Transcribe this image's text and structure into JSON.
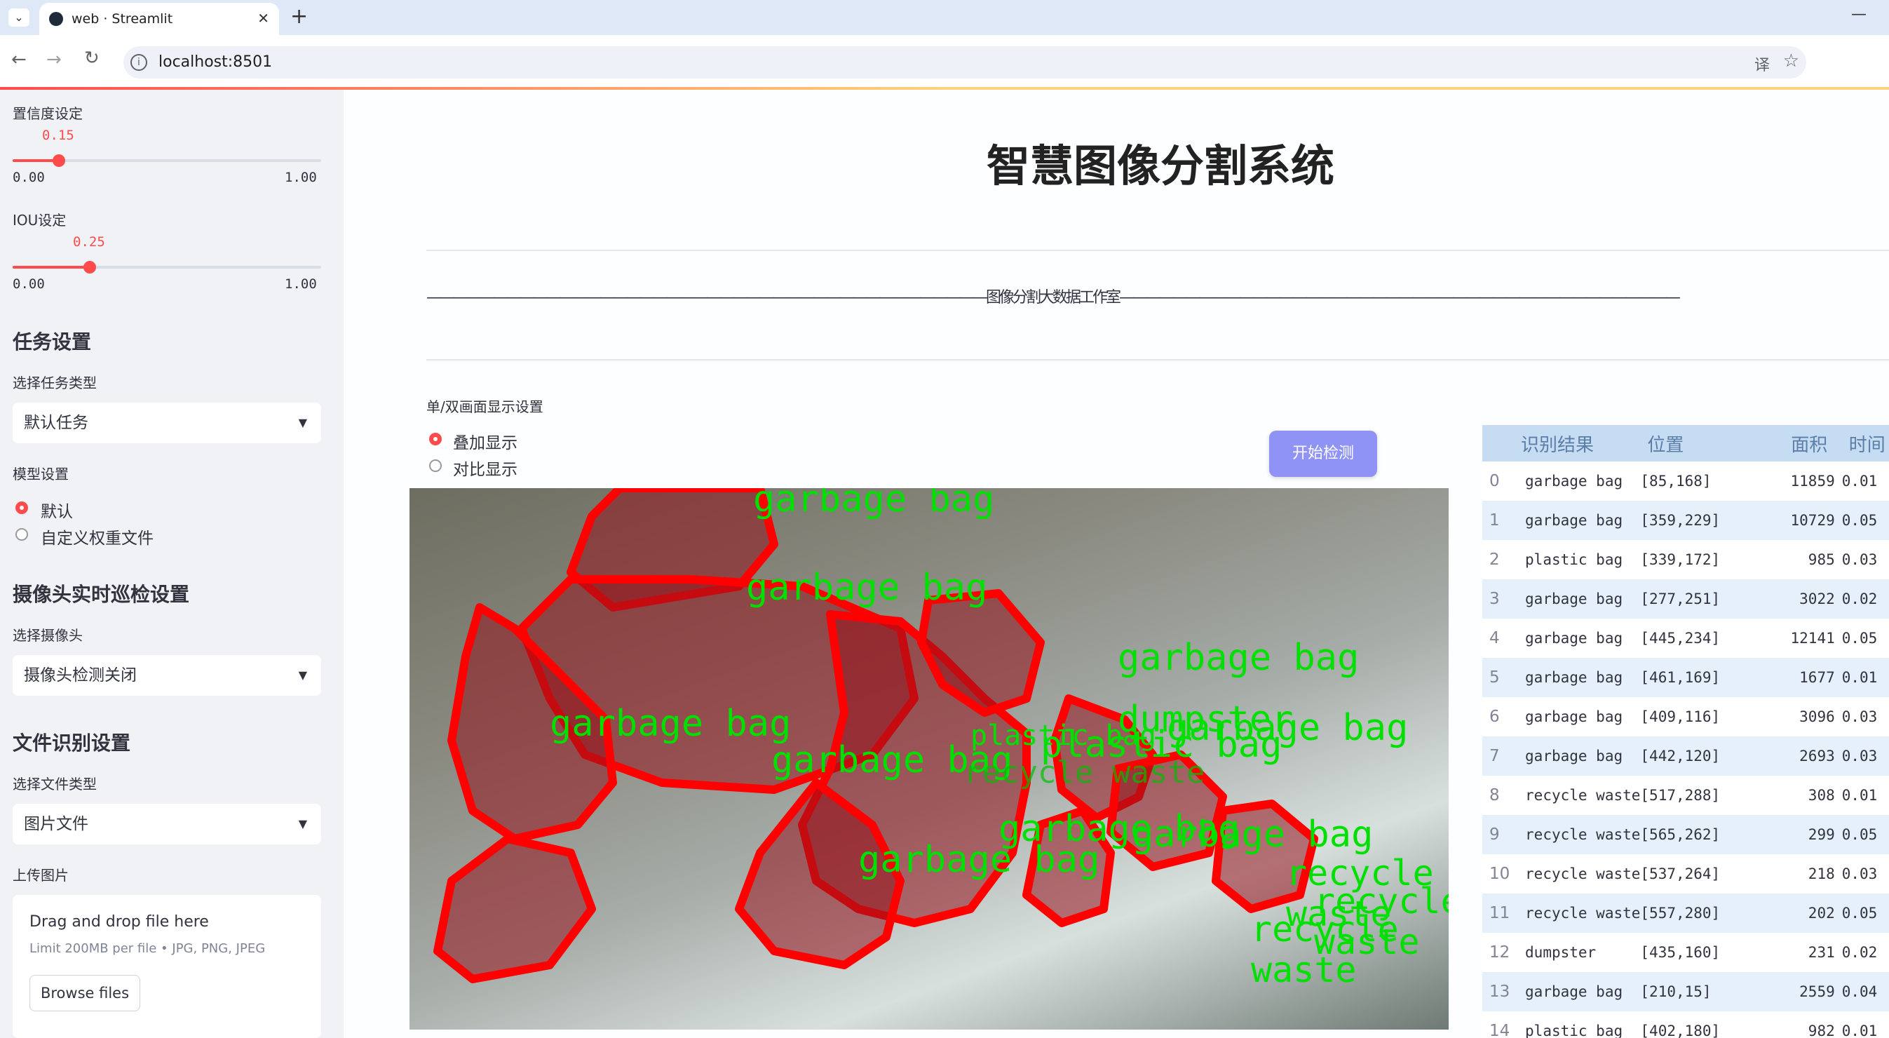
{
  "browser": {
    "tab_title": "web · Streamlit",
    "url": "localhost:8501",
    "new_tab": "+",
    "close_tab": "✕",
    "minimize": "—"
  },
  "sidebar": {
    "confidence_label": "置信度设定",
    "confidence_value": "0.15",
    "confidence": 0.15,
    "confidence_min": "0.00",
    "confidence_max": "1.00",
    "iou_label": "IOU设定",
    "iou_value": "0.25",
    "iou": 0.25,
    "iou_min": "0.00",
    "iou_max": "1.00",
    "task_header": "任务设置",
    "task_type_label": "选择任务类型",
    "task_type_value": "默认任务",
    "model_label": "模型设置",
    "model_options": [
      "默认",
      "自定义权重文件"
    ],
    "model_selected": "默认",
    "camera_header": "摄像头实时巡检设置",
    "camera_label": "选择摄像头",
    "camera_value": "摄像头检测关闭",
    "file_header": "文件识别设置",
    "file_type_label": "选择文件类型",
    "file_type_value": "图片文件",
    "upload_label": "上传图片",
    "drop_text": "Drag and drop file here",
    "drop_limit": "Limit 200MB per file • JPG, PNG, JPEG",
    "browse_button": "Browse files"
  },
  "main": {
    "title": "智慧图像分割系统",
    "subtitle": "——————————————————————————————————————————图像分割大数据工作室——————————————————————————————————————————",
    "display_label": "单/双画面显示设置",
    "display_options": [
      "叠加显示",
      "对比显示"
    ],
    "display_selected": "叠加显示",
    "start_button": "开始检测"
  },
  "results_table": {
    "columns": [
      "",
      "识别结果",
      "位置",
      "面积",
      "时间"
    ],
    "rows": [
      {
        "idx": "0",
        "name": "garbage bag",
        "pos": "[85,168]",
        "area": "11859",
        "time": "0.01"
      },
      {
        "idx": "1",
        "name": "garbage bag",
        "pos": "[359,229]",
        "area": "10729",
        "time": "0.05"
      },
      {
        "idx": "2",
        "name": "plastic bag",
        "pos": "[339,172]",
        "area": "985",
        "time": "0.03"
      },
      {
        "idx": "3",
        "name": "garbage bag",
        "pos": "[277,251]",
        "area": "3022",
        "time": "0.02"
      },
      {
        "idx": "4",
        "name": "garbage bag",
        "pos": "[445,234]",
        "area": "12141",
        "time": "0.05"
      },
      {
        "idx": "5",
        "name": "garbage bag",
        "pos": "[461,169]",
        "area": "1677",
        "time": "0.01"
      },
      {
        "idx": "6",
        "name": "garbage bag",
        "pos": "[409,116]",
        "area": "3096",
        "time": "0.03"
      },
      {
        "idx": "7",
        "name": "garbage bag",
        "pos": "[442,120]",
        "area": "2693",
        "time": "0.03"
      },
      {
        "idx": "8",
        "name": "recycle waste",
        "pos": "[517,288]",
        "area": "308",
        "time": "0.01"
      },
      {
        "idx": "9",
        "name": "recycle waste",
        "pos": "[565,262]",
        "area": "299",
        "time": "0.05"
      },
      {
        "idx": "10",
        "name": "recycle waste",
        "pos": "[537,264]",
        "area": "218",
        "time": "0.03"
      },
      {
        "idx": "11",
        "name": "recycle waste",
        "pos": "[557,280]",
        "area": "202",
        "time": "0.05"
      },
      {
        "idx": "12",
        "name": "dumpster",
        "pos": "[435,160]",
        "area": "231",
        "time": "0.02"
      },
      {
        "idx": "13",
        "name": "garbage bag",
        "pos": "[210,15]",
        "area": "2559",
        "time": "0.04"
      },
      {
        "idx": "14",
        "name": "plastic bag",
        "pos": "[402,180]",
        "area": "982",
        "time": "0.01"
      }
    ]
  },
  "overlay_labels": [
    "garbage bag",
    "garbage bag",
    "garbage bag",
    "garbage bag",
    "garbage bag",
    "garbage bag",
    "garbage bag",
    "garbage bag",
    "garbage bag",
    "plastic bag",
    "plastic bag",
    "dumpster",
    "recycle waste",
    "recycle waste",
    "recycle waste",
    "recycle waste"
  ],
  "colors": {
    "accent": "#ff4b4b",
    "mask": "#ff0000",
    "label_text": "#00e000",
    "start_button": "#8f93f5",
    "table_header": "#c5dcf3"
  }
}
